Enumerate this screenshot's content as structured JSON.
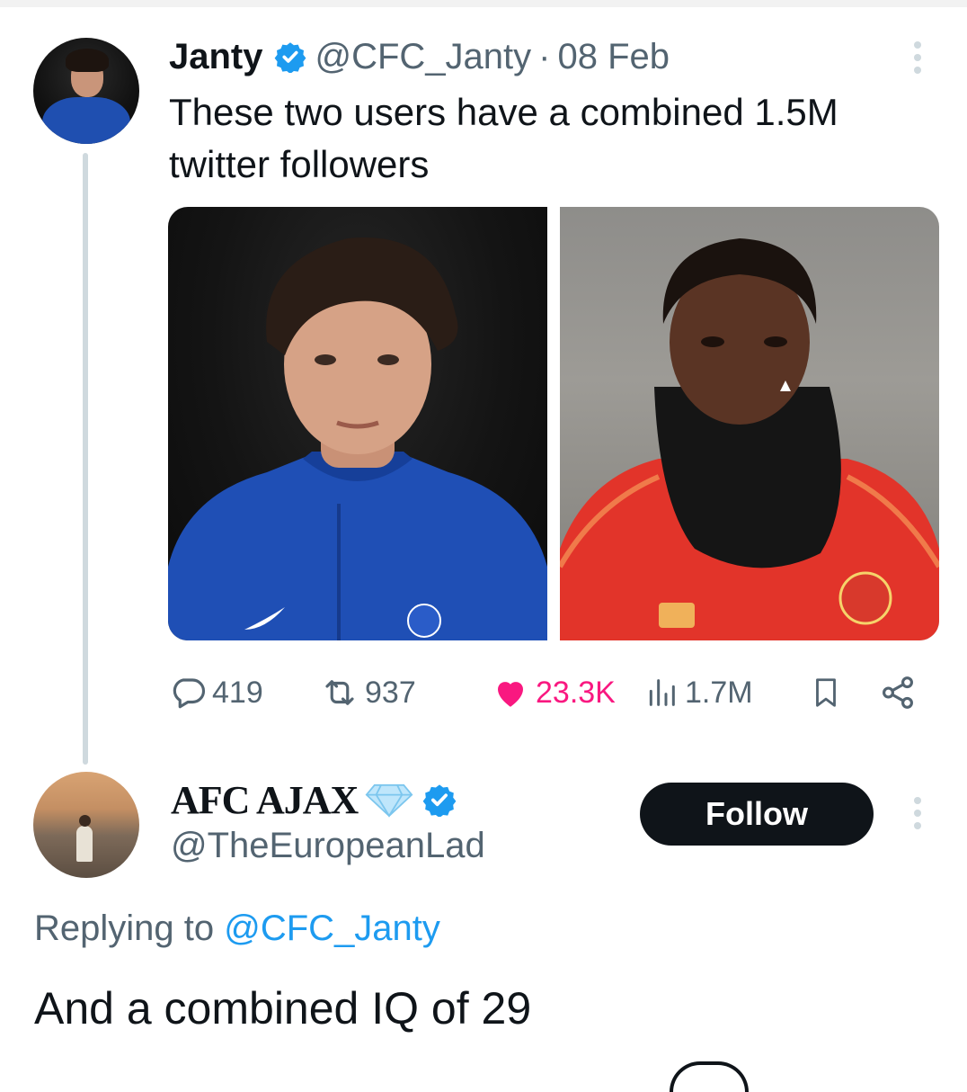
{
  "tweet": {
    "display_name": "Janty",
    "handle": "@CFC_Janty",
    "separator": "·",
    "date": "08 Feb",
    "text": "These two users have a combined 1.5M twitter followers",
    "stats": {
      "replies": "419",
      "retweets": "937",
      "likes": "23.3K",
      "views": "1.7M"
    },
    "icons": {
      "reply": "reply-bubble-icon",
      "retweet": "retweet-icon",
      "like": "heart-icon",
      "views": "views-bar-chart-icon",
      "bookmark": "bookmark-icon",
      "share": "share-icon",
      "more": "more-vertical-icon",
      "verified": "verified-badge-icon"
    },
    "colors": {
      "like": "#f91880",
      "verified": "#1d9bf0",
      "secondary_text": "#536471"
    }
  },
  "reply": {
    "display_name": "AFC AJAX",
    "name_emoji": "gem-icon",
    "handle": "@TheEuropeanLad",
    "follow_label": "Follow",
    "replying_prefix": "Replying to",
    "replying_to": "@CFC_Janty",
    "text": "And a combined IQ of 29"
  }
}
